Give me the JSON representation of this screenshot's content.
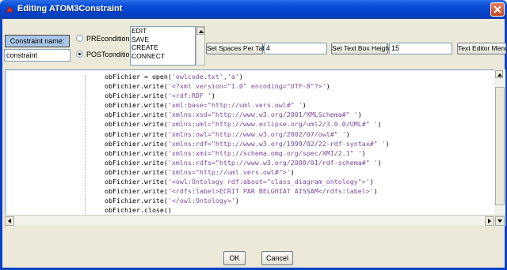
{
  "window": {
    "title": "Editing ATOM3Constraint"
  },
  "constraint": {
    "name_label": "Constraint name:",
    "name_value": "constraint",
    "pre_label": "PREcondition",
    "post_label": "POSTcondition",
    "selected_condition": "POSTcondition"
  },
  "events": [
    "EDIT",
    "SAVE",
    "CREATE",
    "CONNECT"
  ],
  "toolbar": {
    "spaces_label": "Set Spaces Per Tab",
    "spaces_value": "4",
    "height_label": "Set Text Box Height",
    "height_value": "15",
    "editor_label": "Text Editor Menu"
  },
  "code": [
    {
      "fn": "obFichier = open(",
      "str": "'owlcode.txt','a'",
      "end": ")"
    },
    {
      "fn": "obFichier.write(",
      "str": "'<?xml version=\"1.0\" encoding=\"UTF-8\"?>'",
      "end": ")"
    },
    {
      "fn": "obFichier.write(",
      "str": "'<rdf:RDF '",
      "end": ")"
    },
    {
      "fn": "obFichier.write(",
      "str": "'xml:base=\"http://uml.vers.owl#\" '",
      "end": ")"
    },
    {
      "fn": "obFichier.write(",
      "str": "'xmlns:xsd=\"http://www.w3.org/2001/XMLSchema#\" '",
      "end": ")"
    },
    {
      "fn": "obFichier.write(",
      "str": "'xmlns:uml=\"http://www.eclipse.org/uml2/3.0.0/UML#\" '",
      "end": ")"
    },
    {
      "fn": "obFichier.write(",
      "str": "'xmlns:owl=\"http://www.w3.org/2002/07/owl#\" '",
      "end": ")"
    },
    {
      "fn": "obFichier.write(",
      "str": "'xmlns:rdf=\"http://www.w3.org/1999/02/22-rdf-syntax#\" '",
      "end": ")"
    },
    {
      "fn": "obFichier.write(",
      "str": "'xmlns:xmi=\"http://schema.omg.org/spec/XMI/2.1\" '",
      "end": ")"
    },
    {
      "fn": "obFichier.write(",
      "str": "'xmlns:rdfs=\"http://www.w3.org/2000/01/rdf-schema#\" '",
      "end": ")"
    },
    {
      "fn": "obFichier.write(",
      "str": "'xmlns=\"http://uml.vers.owl#\">'",
      "end": ")"
    },
    {
      "fn": "obFichier.write(",
      "str": "'<owl:Ontology rdf:about=\"class_diagram_ontology\">'",
      "end": ")"
    },
    {
      "fn": "obFichier.write(",
      "str": "'<rdfs:label>ECRIT PAR BELGHIAT AISSAM</rdfs:label>'",
      "end": ")"
    },
    {
      "fn": "obFichier.write(",
      "str": "'</owl:Ontology>'",
      "end": ")"
    },
    {
      "fn": "obFichier.close()",
      "str": "",
      "end": ""
    }
  ],
  "footer": {
    "ok_label": "OK",
    "cancel_label": "Cancel"
  },
  "colors": {
    "titlebar": "#0a4fd8",
    "string": "#7a4b9b",
    "label_bg": "#a9c6e8"
  }
}
